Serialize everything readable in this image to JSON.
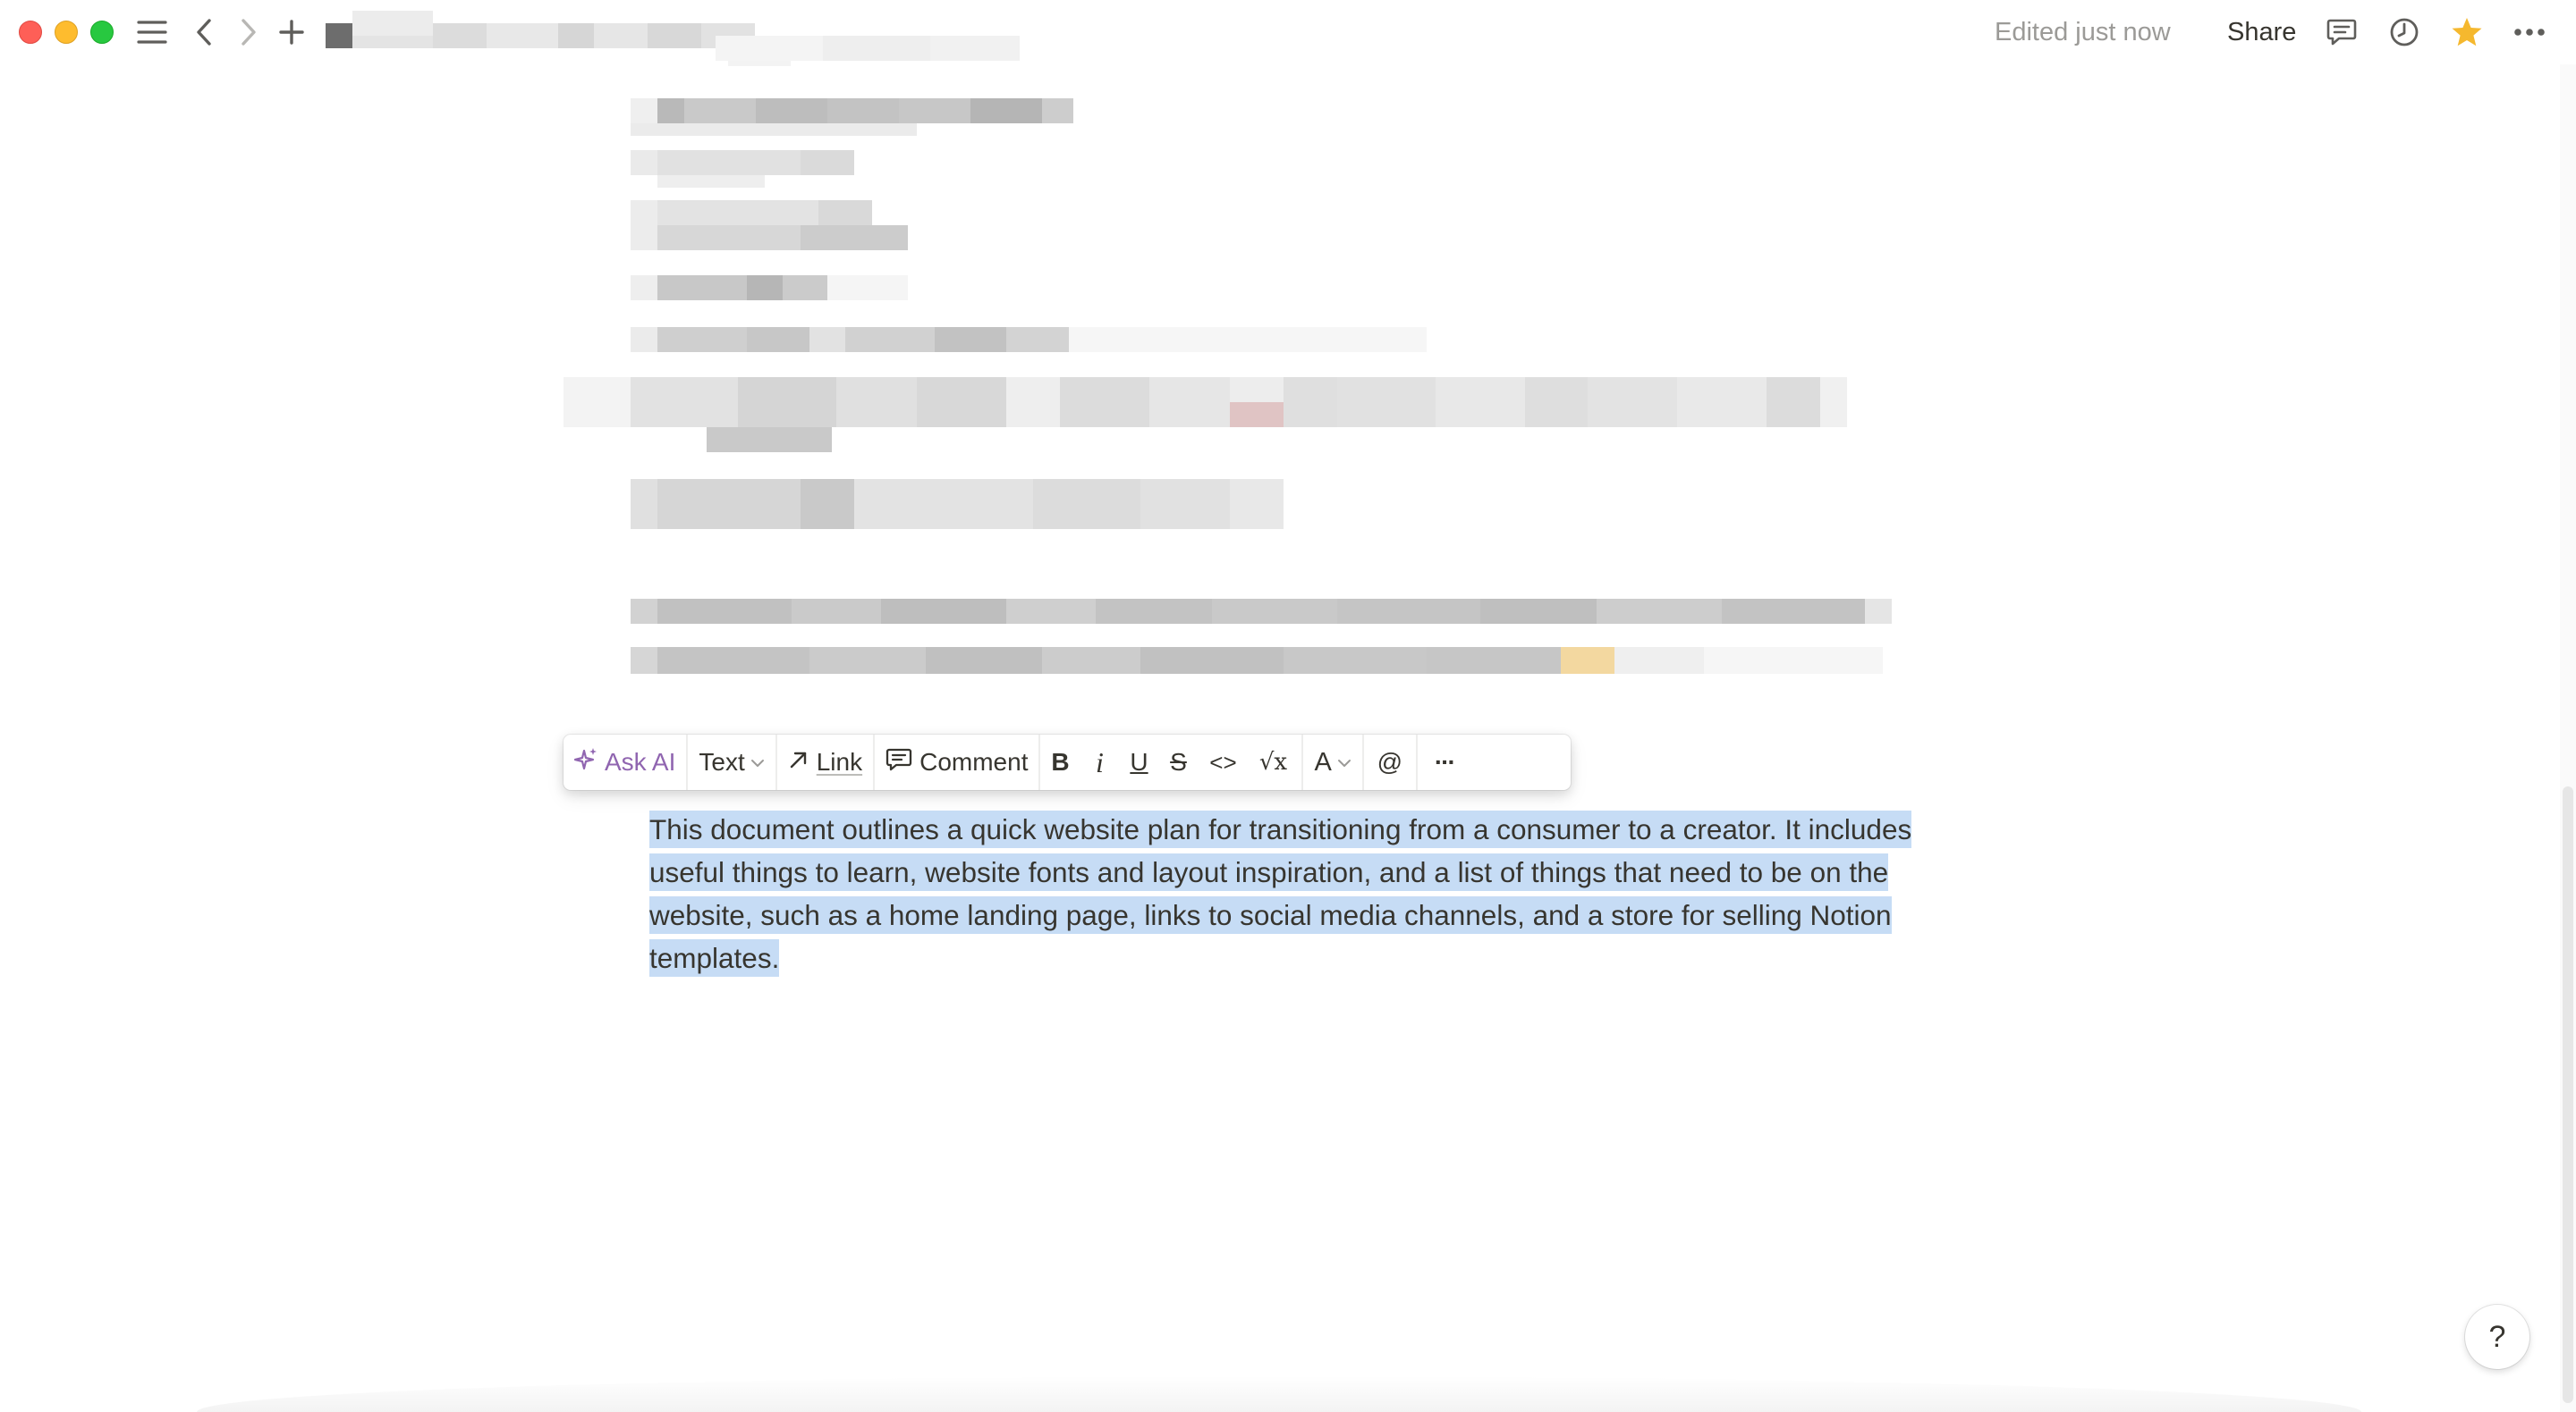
{
  "titlebar": {
    "edited_label": "Edited just now",
    "share_label": "Share",
    "icons": [
      "sidebar-toggle-icon",
      "back-icon",
      "forward-icon",
      "new-page-icon",
      "comments-icon",
      "history-icon",
      "favorite-star-icon",
      "more-icon"
    ],
    "favorite_color": "#f5b82e"
  },
  "toolbar": {
    "ask_ai_label": "Ask AI",
    "block_type_label": "Text",
    "link_label": "Link",
    "comment_label": "Comment",
    "bold_label": "B",
    "italic_label": "i",
    "underline_label": "U",
    "strike_label": "S",
    "code_label": "<>",
    "equation_label": "√x",
    "color_label": "A",
    "mention_label": "@",
    "more_label": "···",
    "ai_color": "#9065b0"
  },
  "document": {
    "selected_paragraph": "This document outlines a quick website plan for transitioning from a consumer to a creator. It includes useful things to learn, website fonts and layout inspiration, and a list of things that need to be on the website, such as a home landing page, links to social media channels, and a store for selling Notion templates.",
    "selection_color": "#c6dcf5"
  },
  "help": {
    "label": "?"
  }
}
